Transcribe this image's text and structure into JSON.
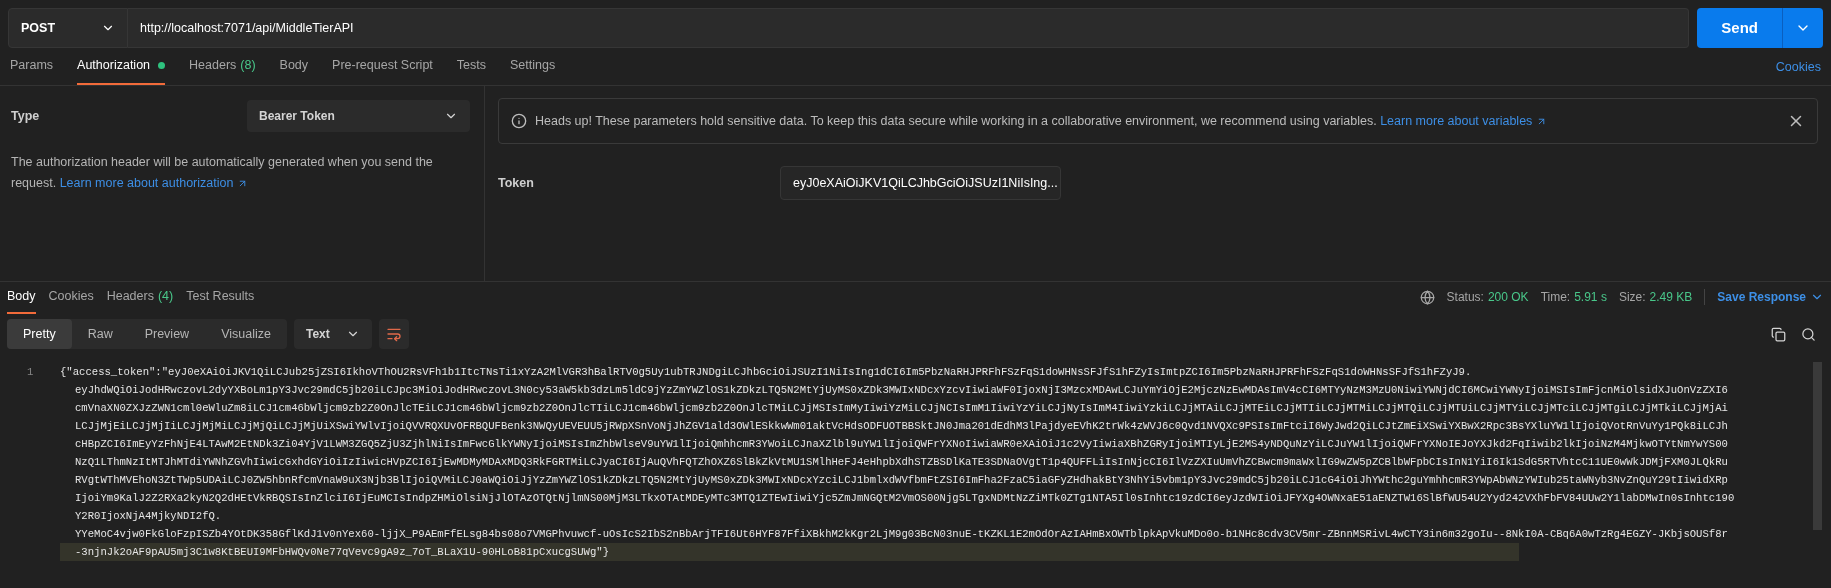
{
  "request": {
    "method": "POST",
    "url": "http://localhost:7071/api/MiddleTierAPI",
    "send_label": "Send"
  },
  "request_tabs": [
    {
      "label": "Params",
      "dot": false,
      "selected": false
    },
    {
      "label": "Authorization",
      "dot": true,
      "selected": true
    },
    {
      "label": "Headers",
      "count": "(8)",
      "dot": false,
      "selected": false
    },
    {
      "label": "Body",
      "dot": false,
      "selected": false
    },
    {
      "label": "Pre-request Script",
      "dot": false,
      "selected": false
    },
    {
      "label": "Tests",
      "dot": false,
      "selected": false
    },
    {
      "label": "Settings",
      "dot": false,
      "selected": false
    }
  ],
  "cookies_link": "Cookies",
  "auth": {
    "type_label": "Type",
    "type_value": "Bearer Token",
    "description": "The authorization header will be automatically generated when you send the request.",
    "learn_more": "Learn more about authorization",
    "notice": {
      "text": "Heads up! These parameters hold sensitive data. To keep this data secure while working in a collaborative environment, we recommend using variables.",
      "link": "Learn more about variables"
    },
    "token_label": "Token",
    "token_value": "eyJ0eXAiOiJKV1QiLCJhbGciOiJSUzI1NiIsIng..."
  },
  "response": {
    "tabs": [
      {
        "label": "Body",
        "selected": true
      },
      {
        "label": "Cookies",
        "selected": false
      },
      {
        "label": "Headers",
        "count": "(4)",
        "selected": false
      },
      {
        "label": "Test Results",
        "selected": false
      }
    ],
    "status_label": "Status:",
    "status": "200 OK",
    "time_label": "Time:",
    "time": "5.91 s",
    "size_label": "Size:",
    "size": "2.49 KB",
    "save_label": "Save Response",
    "views": [
      {
        "label": "Pretty",
        "selected": true
      },
      {
        "label": "Raw",
        "selected": false
      },
      {
        "label": "Preview",
        "selected": false
      },
      {
        "label": "Visualize",
        "selected": false
      }
    ],
    "format": "Text",
    "line_number": "1",
    "lines": [
      {
        "text": "{\"access_token\":\"eyJ0eXAiOiJKV1QiLCJub25jZSI6IkhoVThOU2RsVFh1b1ItcTNsTi1xYzA2MlVGR3hBalRTV0g5Uy1ubTRJNDgiLCJhbGciOiJSUzI1NiIsIng1dCI6Im5PbzNaRHJPRFhFSzFqS1doWHNsSFJfS1hFZyIsImtpZCI6Im5PbzNaRHJPRFhFSzFqS1doWHNsSFJfS1hFZyJ9.",
        "highlighted": false
      },
      {
        "text": "eyJhdWQiOiJodHRwczovL2dyYXBoLm1pY3Jvc29mdC5jb20iLCJpc3MiOiJodHRwczovL3N0cy53aW5kb3dzLm5ldC9jYzZmYWZlOS1kZDkzLTQ5N2MtYjUyMS0xZDk3MWIxNDcxYzcvIiwiaWF0IjoxNjI3MzcxMDAwLCJuYmYiOjE2MjczNzEwMDAsImV4cCI6MTYyNzM3MzU0NiwiYWNjdCI6MCwiYWNyIjoiMSIsImFjcnMiOlsidXJuOnVzZXI6",
        "highlighted": false
      },
      {
        "text": "cmVnaXN0ZXJzZWN1cml0eWluZm8iLCJ1cm46bWljcm9zb2Z0OnJlcTEiLCJ1cm46bWljcm9zb2Z0OnJlcTIiLCJ1cm46bWljcm9zb2Z0OnJlcTMiLCJjMSIsImMyIiwiYzMiLCJjNCIsImM1IiwiYzYiLCJjNyIsImM4IiwiYzkiLCJjMTAiLCJjMTEiLCJjMTIiLCJjMTMiLCJjMTQiLCJjMTUiLCJjMTYiLCJjMTciLCJjMTgiLCJjMTkiLCJjMjAi",
        "highlighted": false
      },
      {
        "text": "LCJjMjEiLCJjMjIiLCJjMjMiLCJjMjQiLCJjMjUiXSwiYWlvIjoiQVVRQXUvOFRBQUFBenk3NWQyUEVEUU5jRWpXSnVoNjJhZGV1ald3OWlESkkwWm01aktVcHdsODFUOTBBSktJN0Jma201dEdhM3lPajdyeEVhK2trWk4zWVJ6c0Qvd1NVQXc9PSIsImFtciI6WyJwd2QiLCJtZmEiXSwiYXBwX2Rpc3BsYXluYW1lIjoiQVotRnVuYy1PQk8iLCJh",
        "highlighted": false
      },
      {
        "text": "cHBpZCI6ImEyYzFhNjE4LTAwM2EtNDk3Zi04YjV1LWM3ZGQ5ZjU3ZjhlNiIsImFwcGlkYWNyIjoiMSIsImZhbWlseV9uYW1lIjoiQmhhcmR3YWoiLCJnaXZlbl9uYW1lIjoiQWFrYXNoIiwiaWR0eXAiOiJ1c2VyIiwiaXBhZGRyIjoiMTIyLjE2MS4yNDQuNzYiLCJuYW1lIjoiQWFrYXNoIEJoYXJkd2FqIiwib2lkIjoiNzM4MjkwOTYtNmYwYS00",
        "highlighted": false
      },
      {
        "text": "NzQ1LThmNzItMTJhMTdiYWNhZGVhIiwicGxhdGYiOiIzIiwicHVpZCI6IjEwMDMyMDAxMDQ3RkFGRTMiLCJyaCI6IjAuQVhFQTZhOXZ6SlBkZkVtMU1SMlhHeFJ4eHhpbXdhSTZBSDlKaTE3SDNaOVgtT1p4QUFFLiIsInNjcCI6IlVzZXIuUmVhZCBwcm9maWxlIG9wZW5pZCBlbWFpbCIsInN1YiI6Ik1SdG5RTVhtcC11UE0wWkJDMjFXM0JLQkRu",
        "highlighted": false
      },
      {
        "text": "RVgtWThMVEhoN3ZtTWp5UDAiLCJ0ZW5hbnRfcmVnaW9uX3Njb3BlIjoiQVMiLCJ0aWQiOiJjYzZmYWZlOS1kZDkzLTQ5N2MtYjUyMS0xZDk3MWIxNDcxYzciLCJ1bmlxdWVfbmFtZSI6ImFha2FzaC5iaGFyZHdhakBtY3NhYi5vbm1pY3Jvc29mdC5jb20iLCJ1cG4iOiJhYWthc2guYmhhcmR3YWpAbWNzYWIub25taWNyb3NvZnQuY29tIiwidXRp",
        "highlighted": false
      },
      {
        "text": "IjoiYm9KalJ2Z2RXa2kyN2Q2dHEtVkRBQSIsInZlciI6IjEuMCIsIndpZHMiOlsiNjJlOTAzOTQtNjlmNS00MjM3LTkxOTAtMDEyMTc3MTQ1ZTEwIiwiYjc5ZmJmNGQtM2VmOS00Njg5LTgxNDMtNzZiMTk0ZTg1NTA5Il0sInhtc19zdCI6eyJzdWIiOiJFYXg4OWNxaE51aENZTW16SlBfWU54U2Yyd242VXhFbFV84UUw2Y1labDMwIn0sInhtc190",
        "highlighted": false
      },
      {
        "text": "Y2R0IjoxNjA4MjkyNDI2fQ.",
        "highlighted": false
      },
      {
        "text": "YYeMoC4vjw0FkGloFzpISZb4YOtDK358GflKdJ1v0nYex60-ljjX_P9AEmFfELsg84bs08o7VMGPhvuwcf-uOsIcS2IbS2nBbArjTFI6Ut6HYF87FfiXBkhM2kKgr2LjM9g03BcN03nuE-tKZKL1E2mOdOrAzIAHmBxOWTblpkApVkuMDo0o-b1NHc8cdv3CV5mr-ZBnnMSRivL4wCTY3in6m32goIu--8NkI0A-CBq6A0wTzRg4EGZY-JKbjsOUSf8r",
        "highlighted": false
      },
      {
        "text": "-3njnJk2oAF9pAU5mj3C1w8KtBEUI9MFbHWQv0Ne77qVevc9gA9z_7oT_BLaX1U-90HLoB81pCxucgSUWg\"}",
        "highlighted": true
      }
    ]
  }
}
